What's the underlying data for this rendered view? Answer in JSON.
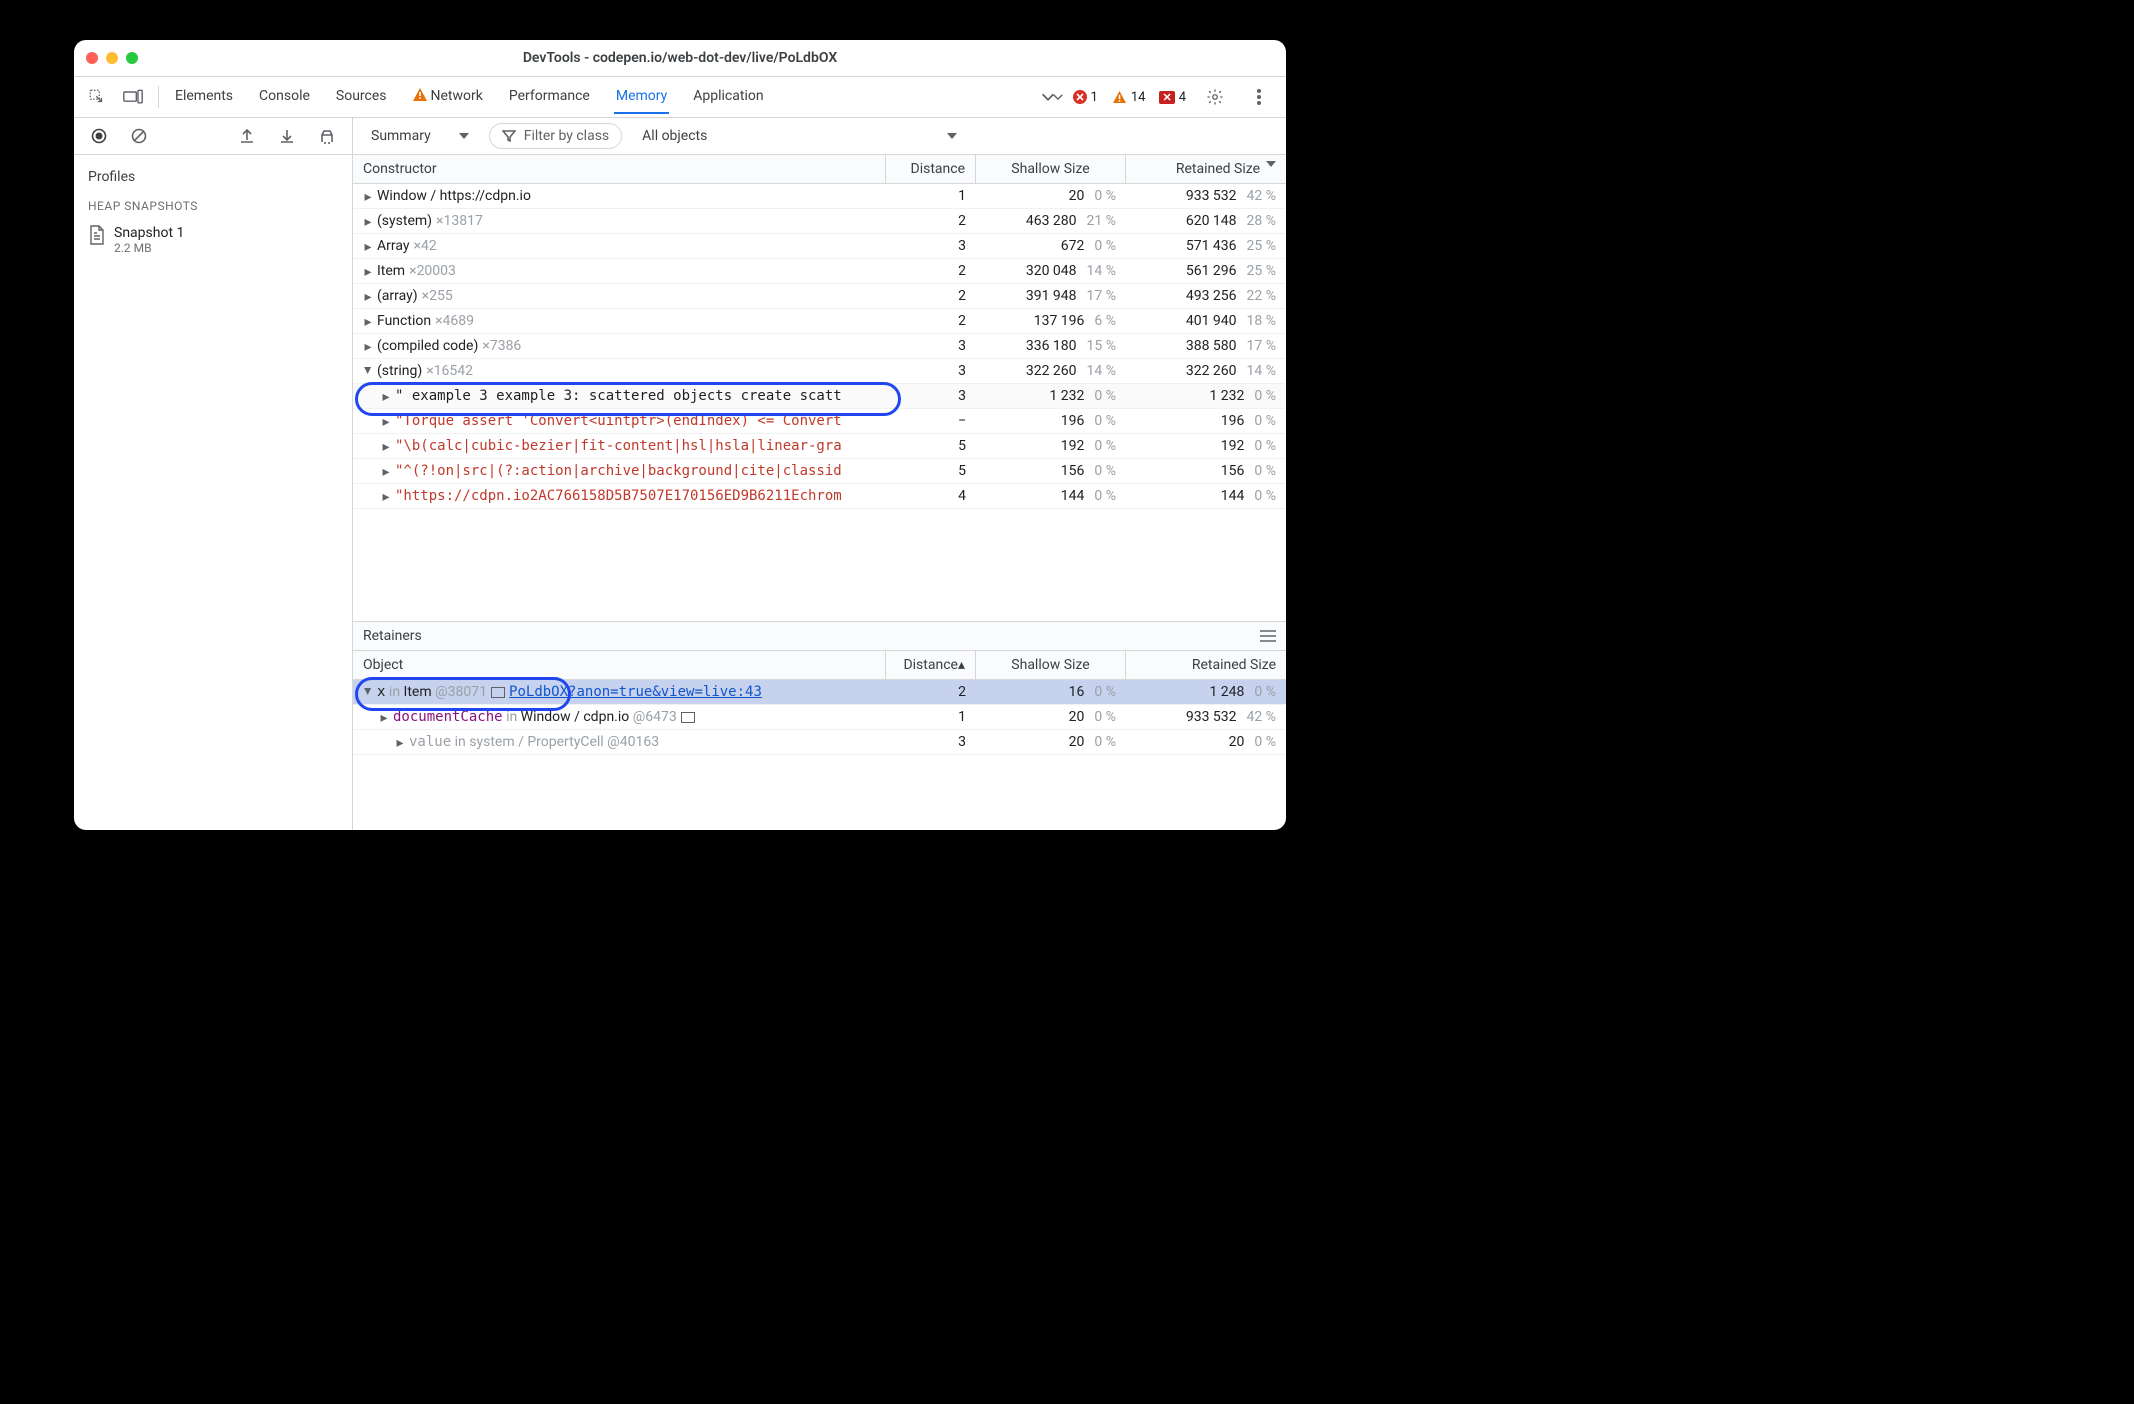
{
  "title": "DevTools - codepen.io/web-dot-dev/live/PoLdbOX",
  "tabs": [
    "Elements",
    "Console",
    "Sources",
    "Network",
    "Performance",
    "Memory",
    "Application"
  ],
  "activeTab": "Memory",
  "status": {
    "errors": "1",
    "warnings": "14",
    "info": "4"
  },
  "toolbar": {
    "view": "Summary",
    "filter_placeholder": "Filter by class",
    "scope": "All objects"
  },
  "sidebar": {
    "profiles_label": "Profiles",
    "section": "HEAP SNAPSHOTS",
    "snapshot_name": "Snapshot 1",
    "snapshot_size": "2.2 MB"
  },
  "headers": {
    "constructor": "Constructor",
    "distance": "Distance",
    "shallow": "Shallow Size",
    "retained": "Retained Size"
  },
  "rows": [
    {
      "indent": 0,
      "open": false,
      "name": "Window / https://cdpn.io",
      "count": "",
      "d": "1",
      "s": "20",
      "sp": "0 %",
      "r": "933 532",
      "rp": "42 %"
    },
    {
      "indent": 0,
      "open": false,
      "name": "(system)",
      "count": "×13817",
      "d": "2",
      "s": "463 280",
      "sp": "21 %",
      "r": "620 148",
      "rp": "28 %"
    },
    {
      "indent": 0,
      "open": false,
      "name": "Array",
      "count": "×42",
      "d": "3",
      "s": "672",
      "sp": "0 %",
      "r": "571 436",
      "rp": "25 %"
    },
    {
      "indent": 0,
      "open": false,
      "name": "Item",
      "count": "×20003",
      "d": "2",
      "s": "320 048",
      "sp": "14 %",
      "r": "561 296",
      "rp": "25 %"
    },
    {
      "indent": 0,
      "open": false,
      "name": "(array)",
      "count": "×255",
      "d": "2",
      "s": "391 948",
      "sp": "17 %",
      "r": "493 256",
      "rp": "22 %"
    },
    {
      "indent": 0,
      "open": false,
      "name": "Function",
      "count": "×4689",
      "d": "2",
      "s": "137 196",
      "sp": "6 %",
      "r": "401 940",
      "rp": "18 %"
    },
    {
      "indent": 0,
      "open": false,
      "name": "(compiled code)",
      "count": "×7386",
      "d": "3",
      "s": "336 180",
      "sp": "15 %",
      "r": "388 580",
      "rp": "17 %"
    },
    {
      "indent": 0,
      "open": true,
      "name": "(string)",
      "count": "×16542",
      "d": "3",
      "s": "322 260",
      "sp": "14 %",
      "r": "322 260",
      "rp": "14 %"
    },
    {
      "indent": 1,
      "open": false,
      "name": "\" example 3 example 3: scattered objects create scatt",
      "count": "",
      "d": "3",
      "s": "1 232",
      "sp": "0 %",
      "r": "1 232",
      "rp": "0 %",
      "hl": true,
      "circle": true,
      "mono": true
    },
    {
      "indent": 1,
      "open": false,
      "name": "\"Torque assert 'Convert<uintptr>(endIndex) <= Convert",
      "count": "",
      "d": "−",
      "s": "196",
      "sp": "0 %",
      "r": "196",
      "rp": "0 %",
      "string": true
    },
    {
      "indent": 1,
      "open": false,
      "name": "\"\\b(calc|cubic-bezier|fit-content|hsl|hsla|linear-gra",
      "count": "",
      "d": "5",
      "s": "192",
      "sp": "0 %",
      "r": "192",
      "rp": "0 %",
      "string": true
    },
    {
      "indent": 1,
      "open": false,
      "name": "\"^(?!on|src|(?:action|archive|background|cite|classid",
      "count": "",
      "d": "5",
      "s": "156",
      "sp": "0 %",
      "r": "156",
      "rp": "0 %",
      "string": true
    },
    {
      "indent": 1,
      "open": false,
      "name": "\"https://cdpn.io2AC766158D5B7507E170156ED9B6211Echrom",
      "count": "",
      "d": "4",
      "s": "144",
      "sp": "0 %",
      "r": "144",
      "rp": "0 %",
      "string": true
    }
  ],
  "retainers": {
    "title": "Retainers",
    "headers": {
      "object": "Object",
      "distance": "Distance",
      "shallow": "Shallow Size",
      "retained": "Retained Size"
    },
    "rows": [
      {
        "open": true,
        "html": "<span class='monoC'>x</span> <span class='grayt'>in</span> Item <span class='grayt'>@38071</span> ",
        "link": "PoLdbOX?anon=true&view=live:43",
        "d": "2",
        "s": "16",
        "sp": "0 %",
        "r": "1 248",
        "rp": "0 %",
        "sel": true,
        "circle": true,
        "icon": true
      },
      {
        "open": false,
        "html": "<span class='elemred monoC'>documentCache</span> <span class='grayt'>in</span> Window / cdpn.io <span class='grayt'>@6473</span> ",
        "d": "1",
        "s": "20",
        "sp": "0 %",
        "r": "933 532",
        "rp": "42 %",
        "icon": true
      },
      {
        "open": false,
        "html": "<span class='grayt monoC'>value</span> <span class='grayt'>in</span> <span class='grayt'>system / PropertyCell</span> <span class='grayt'>@40163</span>",
        "d": "3",
        "s": "20",
        "sp": "0 %",
        "r": "20",
        "rp": "0 %"
      }
    ]
  }
}
